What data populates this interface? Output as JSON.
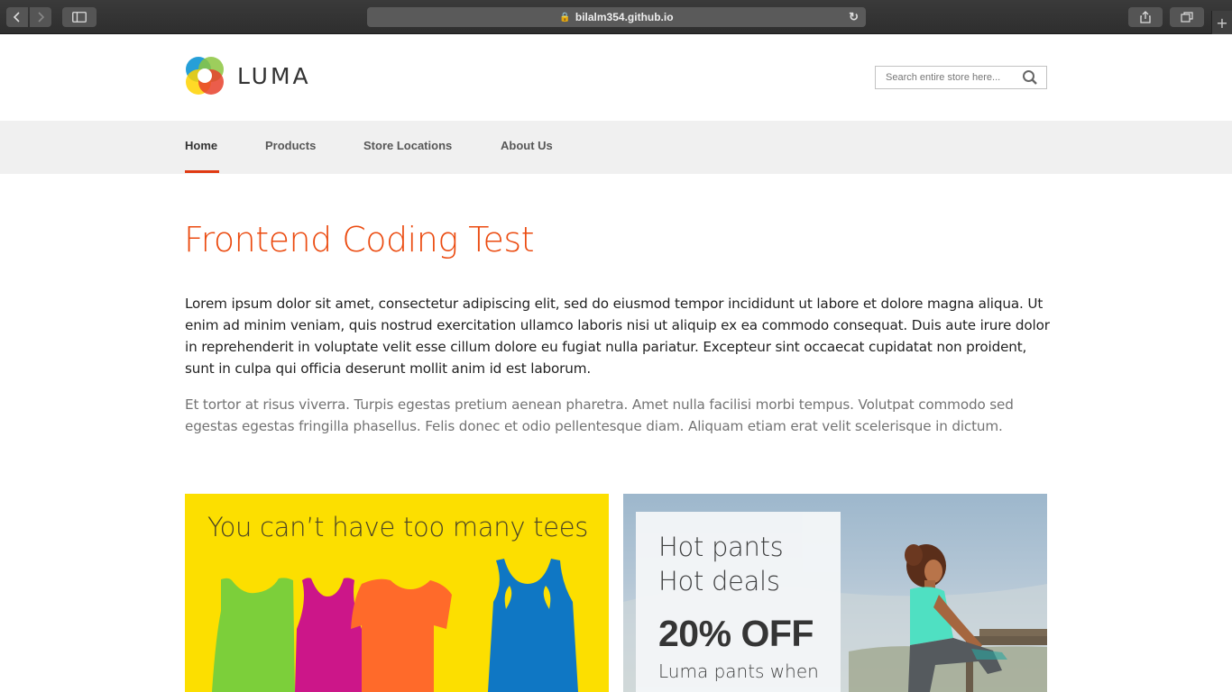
{
  "browser": {
    "url": "bilalm354.github.io"
  },
  "brand": {
    "name": "LUMA",
    "accent_color": "#eb4a0f"
  },
  "search": {
    "placeholder": "Search entire store here..."
  },
  "nav": {
    "items": [
      {
        "label": "Home",
        "active": true
      },
      {
        "label": "Products",
        "active": false
      },
      {
        "label": "Store Locations",
        "active": false
      },
      {
        "label": "About Us",
        "active": false
      }
    ]
  },
  "main": {
    "title": "Frontend Coding Test",
    "paragraph1": "Lorem ipsum dolor sit amet, consectetur adipiscing elit, sed do eiusmod tempor incididunt ut labore et dolore magna aliqua. Ut enim ad minim veniam, quis nostrud exercitation ullamco laboris nisi ut aliquip ex ea commodo consequat. Duis aute irure dolor in reprehenderit in voluptate velit esse cillum dolore eu fugiat nulla pariatur. Excepteur sint occaecat cupidatat non proident, sunt in culpa qui officia deserunt mollit anim id est laborum.",
    "paragraph2": "Et tortor at risus viverra. Turpis egestas pretium aenean pharetra. Amet nulla facilisi morbi tempus. Volutpat commodo sed egestas egestas fringilla phasellus. Felis donec et odio pellentesque diam. Aliquam etiam erat velit scelerisque in dictum."
  },
  "promos": {
    "tees": {
      "heading": "You can’t have too many tees",
      "background": "#fcdf00"
    },
    "pants": {
      "line1": "Hot pants",
      "line2": "Hot deals",
      "discount": "20% OFF",
      "subtext": "Luma pants when"
    }
  }
}
